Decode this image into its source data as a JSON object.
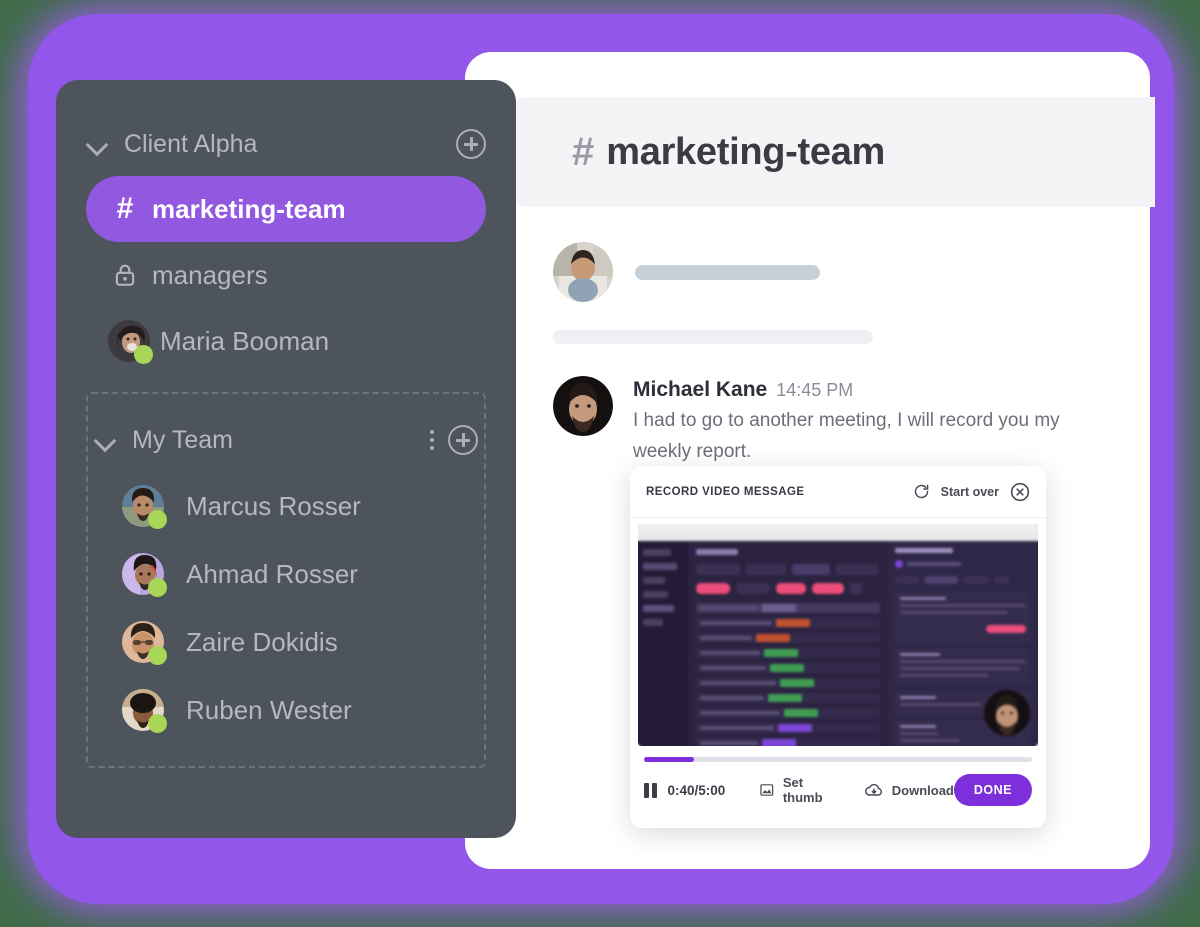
{
  "theme": {
    "accent_purple": "#9258e0",
    "deep_purple": "#7d2fdb",
    "sidebar_bg": "#4e545c",
    "online_green": "#a8d657",
    "card_white": "#ffffff",
    "header_grey": "#f4f4f7"
  },
  "sidebar": {
    "groups": [
      {
        "name": "Client Alpha",
        "collapse_icon": "chevron-down-icon",
        "add_icon": "plus-circle-icon",
        "has_more_menu": false,
        "items": [
          {
            "label": "marketing-team",
            "type": "channel",
            "icon": "hash-icon",
            "active": true
          },
          {
            "label": "managers",
            "type": "private-channel",
            "icon": "lock-icon",
            "active": false
          },
          {
            "label": "Maria Booman",
            "type": "person",
            "icon": "avatar",
            "status": "online",
            "active": false
          }
        ]
      },
      {
        "name": "My Team",
        "collapse_icon": "chevron-down-icon",
        "more_icon": "more-vertical-icon",
        "add_icon": "plus-circle-icon",
        "has_more_menu": true,
        "dashed_outline": true,
        "items": [
          {
            "label": "Marcus Rosser",
            "type": "person",
            "icon": "avatar",
            "status": "online",
            "active": false
          },
          {
            "label": "Ahmad Rosser",
            "type": "person",
            "icon": "avatar",
            "status": "online",
            "active": false
          },
          {
            "label": "Zaire Dokidis",
            "type": "person",
            "icon": "avatar",
            "status": "online",
            "active": false
          },
          {
            "label": "Ruben Wester",
            "type": "person",
            "icon": "avatar",
            "status": "online",
            "active": false
          }
        ]
      }
    ]
  },
  "channel_header": {
    "hash": "#",
    "title": "marketing-team"
  },
  "messages": [
    {
      "type": "placeholder",
      "avatar": "user-avatar",
      "bars": [
        "long",
        "longer"
      ]
    },
    {
      "type": "message",
      "author": "Michael Kane",
      "time": "14:45 PM",
      "text": "I had to go to another meeting, I will record you my weekly report."
    }
  ],
  "recorder": {
    "title": "RECORD VIDEO MESSAGE",
    "start_over_label": "Start over",
    "start_over_icon": "refresh-icon",
    "close_icon": "close-circle-icon",
    "pause_icon": "pause-icon",
    "time_current": "0:40",
    "time_total": "5:00",
    "time_display": "0:40/5:00",
    "progress_percent": 13,
    "set_thumb_label": "Set thumb",
    "set_thumb_icon": "image-icon",
    "download_label": "Download",
    "download_icon": "cloud-download-icon",
    "done_label": "DONE",
    "video_preview": {
      "description": "dark-mode project board screenshot",
      "camera_bubble": "presenter-webcam-avatar"
    }
  }
}
